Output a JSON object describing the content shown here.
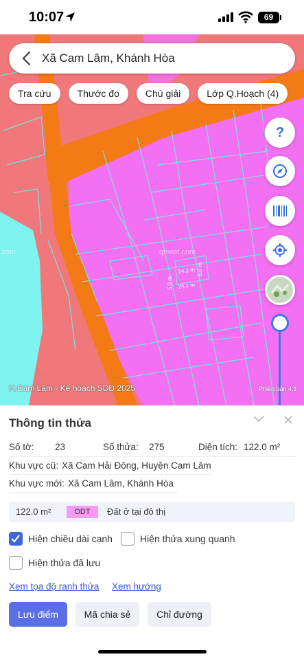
{
  "status": {
    "time": "10:07",
    "battery": "69"
  },
  "search": {
    "title": "Xã Cam Lâm, Khánh Hòa"
  },
  "chips": [
    "Tra cứu",
    "Thước đo",
    "Chú giải",
    "Lớp Q.Hoạch (4)"
  ],
  "fabs": {
    "help": "?"
  },
  "map": {
    "plan_label": "H.Cam Lâm - Kế hoạch SDĐ 2025",
    "version": "Phiên bản 4.1",
    "watermark_1": "gnviet.com",
    "watermark_2": "qnviet.com",
    "dims": {
      "top": "24.2 m",
      "bottom": "24.1 m",
      "left": "5.0 m",
      "right": "5.0 m"
    },
    "colors": {
      "land_odt": "#f470f2",
      "road": "#f47a16",
      "zone": "#f0787a",
      "water": "#7ef3f0",
      "boundary": "#7fe0dc"
    }
  },
  "panel": {
    "title": "Thông tin thửa",
    "so_to_label": "Số tờ:",
    "so_to": "23",
    "so_thua_label": "Số thửa:",
    "so_thua": "275",
    "dien_tich_label": "Diện tích:",
    "dien_tich": "122.0 m²",
    "old_area_label": "Khu vực cũ:",
    "old_area": "Xã Cam Hải Đông, Huyện Cam Lâm",
    "new_area_label": "Khu vực mới:",
    "new_area": "Xã Cam Lâm, Khánh Hòa",
    "area_bar": {
      "value": "122.0 m²",
      "code": "ODT",
      "type": "Đất ở tại đô thị",
      "code_color": "#f59bf3"
    },
    "checkboxes": [
      {
        "label": "Hiện chiều dài cạnh",
        "checked": true
      },
      {
        "label": "Hiện thửa xung quanh",
        "checked": false
      },
      {
        "label": "Hiện thửa đã lưu",
        "checked": false
      }
    ],
    "links": [
      "Xem tọa độ ranh thửa",
      "Xem hướng"
    ],
    "buttons": {
      "save": "Lưu điểm",
      "share": "Mã chia sẻ",
      "directions": "Chỉ đường"
    }
  }
}
